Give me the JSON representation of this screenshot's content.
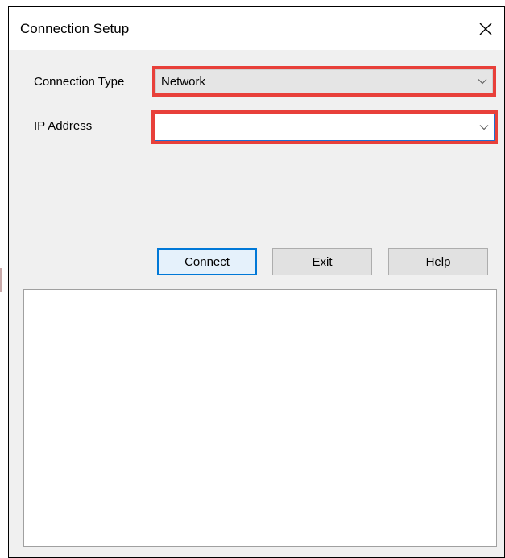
{
  "window": {
    "title": "Connection Setup"
  },
  "form": {
    "connection_type": {
      "label": "Connection Type",
      "value": "Network"
    },
    "ip_address": {
      "label": "IP Address",
      "value": ""
    }
  },
  "buttons": {
    "connect": "Connect",
    "exit": "Exit",
    "help": "Help"
  },
  "icons": {
    "close": "close-icon",
    "dropdown": "chevron-down-icon"
  },
  "colors": {
    "highlight": "#e8403a",
    "focus": "#0078d7",
    "dialog_bg": "#f0f0f0"
  }
}
